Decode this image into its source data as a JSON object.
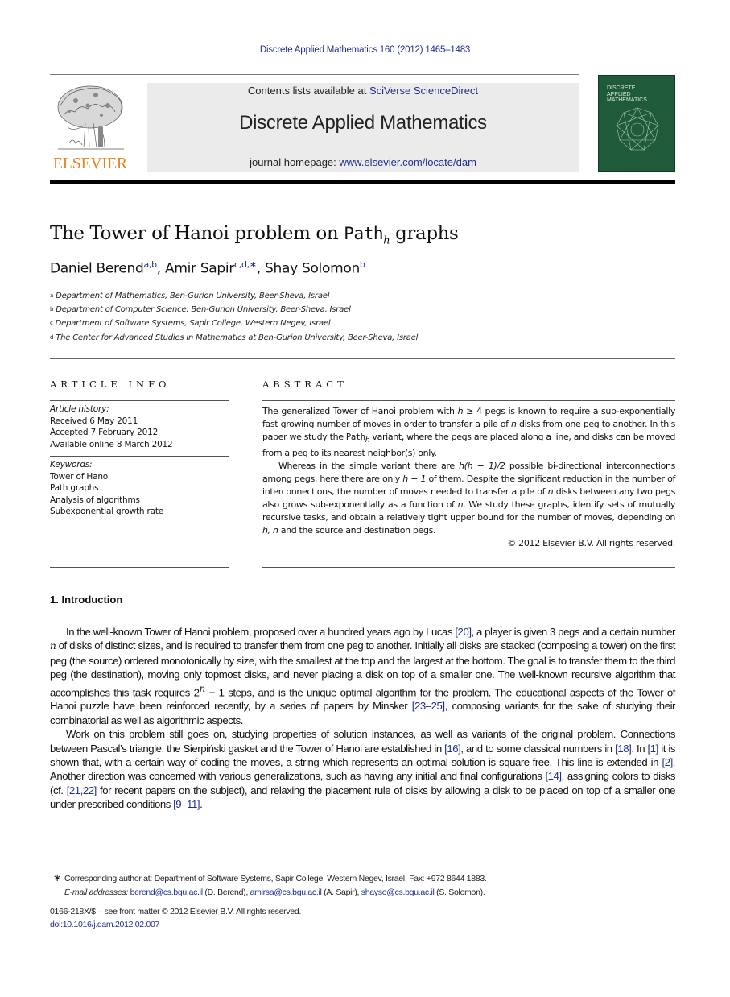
{
  "header": {
    "journal_ref": "Discrete Applied Mathematics 160 (2012) 1465–1483",
    "contents_prefix": "Contents lists available at ",
    "contents_link": "SciVerse ScienceDirect",
    "journal_title": "Discrete Applied Mathematics",
    "homepage_prefix": "journal homepage: ",
    "homepage_link": "www.elsevier.com/locate/dam",
    "publisher_logo_text": "ELSEVIER",
    "publisher_logo_icon": "elsevier-tree-icon",
    "cover": {
      "title_lines": [
        "DISCRETE",
        "APPLIED",
        "MATHEMATICS"
      ],
      "icon": "polygon-graph-icon",
      "color": "#1f5a3a"
    },
    "colors": {
      "link": "#1f2f8f",
      "logo": "#e8821e",
      "masthead_bg": "#ebebeb"
    }
  },
  "article": {
    "title_pre": "The Tower of Hanoi problem on ",
    "title_mono": "Path",
    "title_sub": "h",
    "title_post": " graphs",
    "authors": [
      {
        "name": "Daniel Berend",
        "sup": "a,b"
      },
      {
        "name": "Amir Sapir",
        "sup": "c,d,∗"
      },
      {
        "name": "Shay Solomon",
        "sup": "b"
      }
    ],
    "affiliations": [
      {
        "mark": "a",
        "text": "Department of Mathematics, Ben-Gurion University, Beer-Sheva, Israel"
      },
      {
        "mark": "b",
        "text": "Department of Computer Science, Ben-Gurion University, Beer-Sheva, Israel"
      },
      {
        "mark": "c",
        "text": "Department of Software Systems, Sapir College, Western Negev, Israel"
      },
      {
        "mark": "d",
        "text": "The Center for Advanced Studies in Mathematics at Ben-Gurion University, Beer-Sheva, Israel"
      }
    ]
  },
  "article_info": {
    "heading": "ARTICLE INFO",
    "history_label": "Article history:",
    "history": [
      "Received 6 May 2011",
      "Accepted 7 February 2012",
      "Available online 8 March 2012"
    ],
    "keywords_label": "Keywords:",
    "keywords": [
      "Tower of Hanoi",
      "Path graphs",
      "Analysis of algorithms",
      "Subexponential growth rate"
    ]
  },
  "abstract": {
    "heading": "ABSTRACT",
    "p1": {
      "a": "The generalized Tower of Hanoi problem with ",
      "b": "h",
      "c": " ≥ 4 pegs is known to require a sub-exponentially fast growing number of moves in order to transfer a pile of ",
      "d": "n",
      "e": " disks from one peg to another. In this paper we study the ",
      "f": "Path",
      "g": "h",
      "h": " variant, where the pegs are placed along a line, and disks can be moved from a peg to its nearest neighbor(s) only."
    },
    "p2": {
      "a": "Whereas in the simple variant there are ",
      "b": "h(h − 1)/2",
      "c": " possible bi-directional interconnections among pegs, here there are only ",
      "d": "h − 1",
      "e": " of them. Despite the significant reduction in the number of interconnections, the number of moves needed to transfer a pile of ",
      "f": "n",
      "g": " disks between any two pegs also grows sub-exponentially as a function of ",
      "h": "n",
      "i": ". We study these graphs, identify sets of mutually recursive tasks, and obtain a relatively tight upper bound for the number of moves, depending on ",
      "j": "h, n",
      "k": " and the source and destination pegs."
    },
    "copyright": "© 2012 Elsevier B.V. All rights reserved."
  },
  "introduction": {
    "heading": "1.  Introduction",
    "p1": {
      "a": "In the well-known Tower of Hanoi problem, proposed over a hundred years ago by Lucas ",
      "ref1": "[20]",
      "b": ", a player is given 3 pegs and a certain number ",
      "n": "n",
      "c": " of disks of distinct sizes, and is required to transfer them from one peg to another. Initially all disks are stacked (composing a tower) on the first peg (the source) ordered monotonically by size, with the smallest at the top and the largest at the bottom. The goal is to transfer them to the third peg (the destination), moving only topmost disks, and never placing a disk on top of a smaller one. The well-known recursive algorithm that accomplishes this task requires 2",
      "sup": "n",
      "d": " − 1 steps, and is the unique optimal algorithm for the problem. The educational aspects of the Tower of Hanoi puzzle have been reinforced recently, by a series of papers by Minsker ",
      "ref2": "[23–25]",
      "e": ", composing variants for the sake of studying their combinatorial as well as algorithmic aspects."
    },
    "p2": {
      "a": "Work on this problem still goes on, studying properties of solution instances, as well as variants of the original problem. Connections between Pascal’s triangle, the Sierpiński gasket and the Tower of Hanoi are established in ",
      "ref1": "[16]",
      "b": ", and to some classical numbers in ",
      "ref2": "[18]",
      "c": ". In ",
      "ref3": "[1]",
      "d": " it is shown that, with a certain way of coding the moves, a string which represents an optimal solution is square-free. This line is extended in ",
      "ref4": "[2]",
      "e": ". Another direction was concerned with various generalizations, such as having any initial and final configurations ",
      "ref5": "[14]",
      "f": ", assigning colors to disks (cf. ",
      "ref6": "[21,22]",
      "g": " for recent papers on the subject), and relaxing the placement rule of disks by allowing a disk to be placed on top of a smaller one under prescribed conditions ",
      "ref7": "[9–11]",
      "h": "."
    }
  },
  "footnotes": {
    "star": "∗",
    "corresponding": "Corresponding author at: Department of Software Systems, Sapir College, Western Negev, Israel. Fax: +972 8644 1883.",
    "email_label": "E-mail addresses: ",
    "emails": [
      {
        "address": "berend@cs.bgu.ac.il",
        "who": " (D. Berend), "
      },
      {
        "address": "amirsa@cs.bgu.ac.il",
        "who": " (A. Sapir), "
      },
      {
        "address": "shayso@cs.bgu.ac.il",
        "who": " (S. Solomon)."
      }
    ],
    "front_matter": "0166-218X/$ – see front matter © 2012 Elsevier B.V. All rights reserved.",
    "doi": "doi:10.1016/j.dam.2012.02.007"
  }
}
